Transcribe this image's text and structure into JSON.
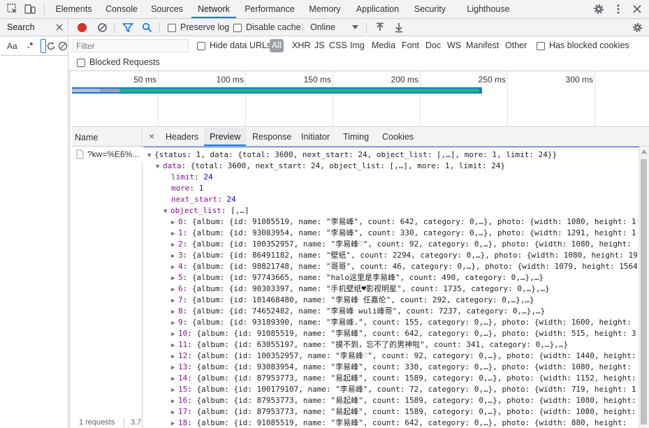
{
  "topbar": {
    "tabs": [
      "Elements",
      "Console",
      "Sources",
      "Network",
      "Performance",
      "Memory",
      "Application",
      "Security",
      "Lighthouse"
    ],
    "active_tab": "Network",
    "icons": [
      "inspect-icon",
      "device-toolbar-icon",
      "settings-gear-icon",
      "more-vert-icon",
      "close-icon"
    ]
  },
  "search_pane": {
    "title": "Search",
    "match_case_label": "Aa",
    "regex_label": ".*"
  },
  "network_toolbar": {
    "preserve_log_label": "Preserve log",
    "disable_cache_label": "Disable cache",
    "throttle_value": "Online",
    "record_color": "#d93025"
  },
  "filter_bar": {
    "filter_placeholder": "Filter",
    "hide_data_urls_label": "Hide data URLs",
    "types": [
      "All",
      "XHR",
      "JS",
      "CSS",
      "Img",
      "Media",
      "Font",
      "Doc",
      "WS",
      "Manifest",
      "Other"
    ],
    "active_type": "All",
    "has_blocked_cookies_label": "Has blocked cookies",
    "blocked_requests_label": "Blocked Requests"
  },
  "overview": {
    "ticks": [
      "50 ms",
      "100 ms",
      "150 ms",
      "200 ms",
      "250 ms",
      "300 ms"
    ],
    "bar_color": "#1a73e8",
    "waiting_color": "#1db87a"
  },
  "requests": {
    "name_header": "Name",
    "items": [
      "?kw=%E6%..."
    ],
    "status": "1 requests",
    "status_trunc": "3.7"
  },
  "detail": {
    "tabs": [
      "Headers",
      "Preview",
      "Response",
      "Initiator",
      "Timing",
      "Cookies"
    ],
    "active_tab": "Preview",
    "close_label": "×"
  },
  "preview": {
    "root": "{status: 1, data: {total: 3600, next_start: 24, object_list: [,…], more: 1, limit: 24}}",
    "data_line": "{total: 3600, next_start: 24, object_list: [,…], more: 1, limit: 24}",
    "limit": "24",
    "more": "1",
    "next_start": "24",
    "object_list_summary": "[,…]",
    "items": [
      {
        "idx": "0",
        "text": "{album: {id: 91085519, name: \"李易峰\", count: 642, category: 0,…}, photo: {width: 1080, height: 1"
      },
      {
        "idx": "1",
        "text": "{album: {id: 93083954, name: \"李易峰\", count: 330, category: 0,…}, photo: {width: 1291, height: 1"
      },
      {
        "idx": "2",
        "text": "{album: {id: 100352957, name: \"李易峰♡\", count: 92, category: 0,…}, photo: {width: 1080, height:"
      },
      {
        "idx": "3",
        "text": "{album: {id: 86491182, name: \"壁纸\", count: 2294, category: 0,…}, photo: {width: 1080, height: 19"
      },
      {
        "idx": "4",
        "text": "{album: {id: 98821748, name: \"哥哥\", count: 46, category: 0,…}, photo: {width: 1079, height: 1564"
      },
      {
        "idx": "5",
        "text": "{album: {id: 97743665, name: \"halo这里是李易峰\", count: 490, category: 0,…},…}"
      },
      {
        "idx": "6",
        "text": "{album: {id: 90303397, name: \"手机壁纸♥影视明星\", count: 1735, category: 0,…},…}"
      },
      {
        "idx": "7",
        "text": "{album: {id: 101468480, name: \"李易峰 任嘉伦\", count: 292, category: 0,…},…}"
      },
      {
        "idx": "8",
        "text": "{album: {id: 74652482, name: \"李易峰 wuli峰哥\", count: 7237, category: 0,…},…}"
      },
      {
        "idx": "9",
        "text": "{album: {id: 93189390, name: \"李易峰.\", count: 155, category: 0,…}, photo: {width: 1600, height:"
      },
      {
        "idx": "10",
        "text": "{album: {id: 91085519, name: \"李易峰\", count: 642, category: 0,…}, photo: {width: 515, height: 3"
      },
      {
        "idx": "11",
        "text": "{album: {id: 63055197, name: \"摸不到，忘不了的男神啦\", count: 341, category: 0,…},…}"
      },
      {
        "idx": "12",
        "text": "{album: {id: 100352957, name: \"李易峰♡\", count: 92, category: 0,…}, photo: {width: 1440, height:"
      },
      {
        "idx": "13",
        "text": "{album: {id: 93083954, name: \"李易峰\", count: 330, category: 0,…}, photo: {width: 1080, height:"
      },
      {
        "idx": "14",
        "text": "{album: {id: 87953773, name: \"易起峰\", count: 1589, category: 0,…}, photo: {width: 1152, height:"
      },
      {
        "idx": "15",
        "text": "{album: {id: 100179107, name: \"李易峰\", count: 72, category: 0,…}, photo: {width: 719, height: 1"
      },
      {
        "idx": "16",
        "text": "{album: {id: 87953773, name: \"易起峰\", count: 1589, category: 0,…}, photo: {width: 1080, height:"
      },
      {
        "idx": "17",
        "text": "{album: {id: 87953773, name: \"易起峰\", count: 1589, category: 0,…}, photo: {width: 1080, height:"
      },
      {
        "idx": "18",
        "text": "{album: {id: 91085519, name: \"李易峰\", count: 642, category: 0,…}, photo: {width: 880, height:"
      }
    ]
  }
}
